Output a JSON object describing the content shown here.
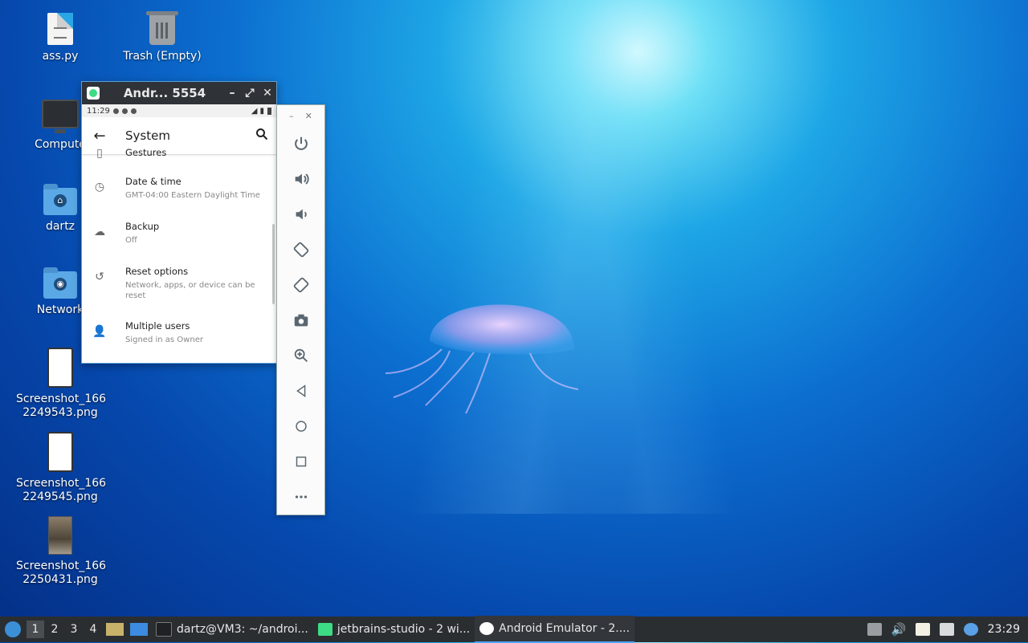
{
  "desktop": {
    "icons": [
      {
        "label": "ass.py"
      },
      {
        "label": "Trash (Empty)"
      },
      {
        "label": "Compute"
      },
      {
        "label": "dartz"
      },
      {
        "label": "Network"
      },
      {
        "label": "Screenshot_166\n2249543.png"
      },
      {
        "label": "Screenshot_166\n2249545.png"
      },
      {
        "label": "Screenshot_166\n2250431.png"
      }
    ]
  },
  "emulator": {
    "title": "Andr... 5554",
    "status_time": "11:29",
    "screen_title": "System",
    "items": [
      {
        "title": "Gestures",
        "subtitle": ""
      },
      {
        "title": "Date & time",
        "subtitle": "GMT-04:00 Eastern Daylight Time"
      },
      {
        "title": "Backup",
        "subtitle": "Off"
      },
      {
        "title": "Reset options",
        "subtitle": "Network, apps, or device can be reset"
      },
      {
        "title": "Multiple users",
        "subtitle": "Signed in as Owner"
      }
    ]
  },
  "taskbar": {
    "workspaces": [
      "1",
      "2",
      "3",
      "4"
    ],
    "tasks": [
      {
        "label": "dartz@VM3: ~/androi..."
      },
      {
        "label": "jetbrains-studio - 2 wi..."
      },
      {
        "label": "Android Emulator - 2...."
      }
    ],
    "clock": "23:29"
  }
}
